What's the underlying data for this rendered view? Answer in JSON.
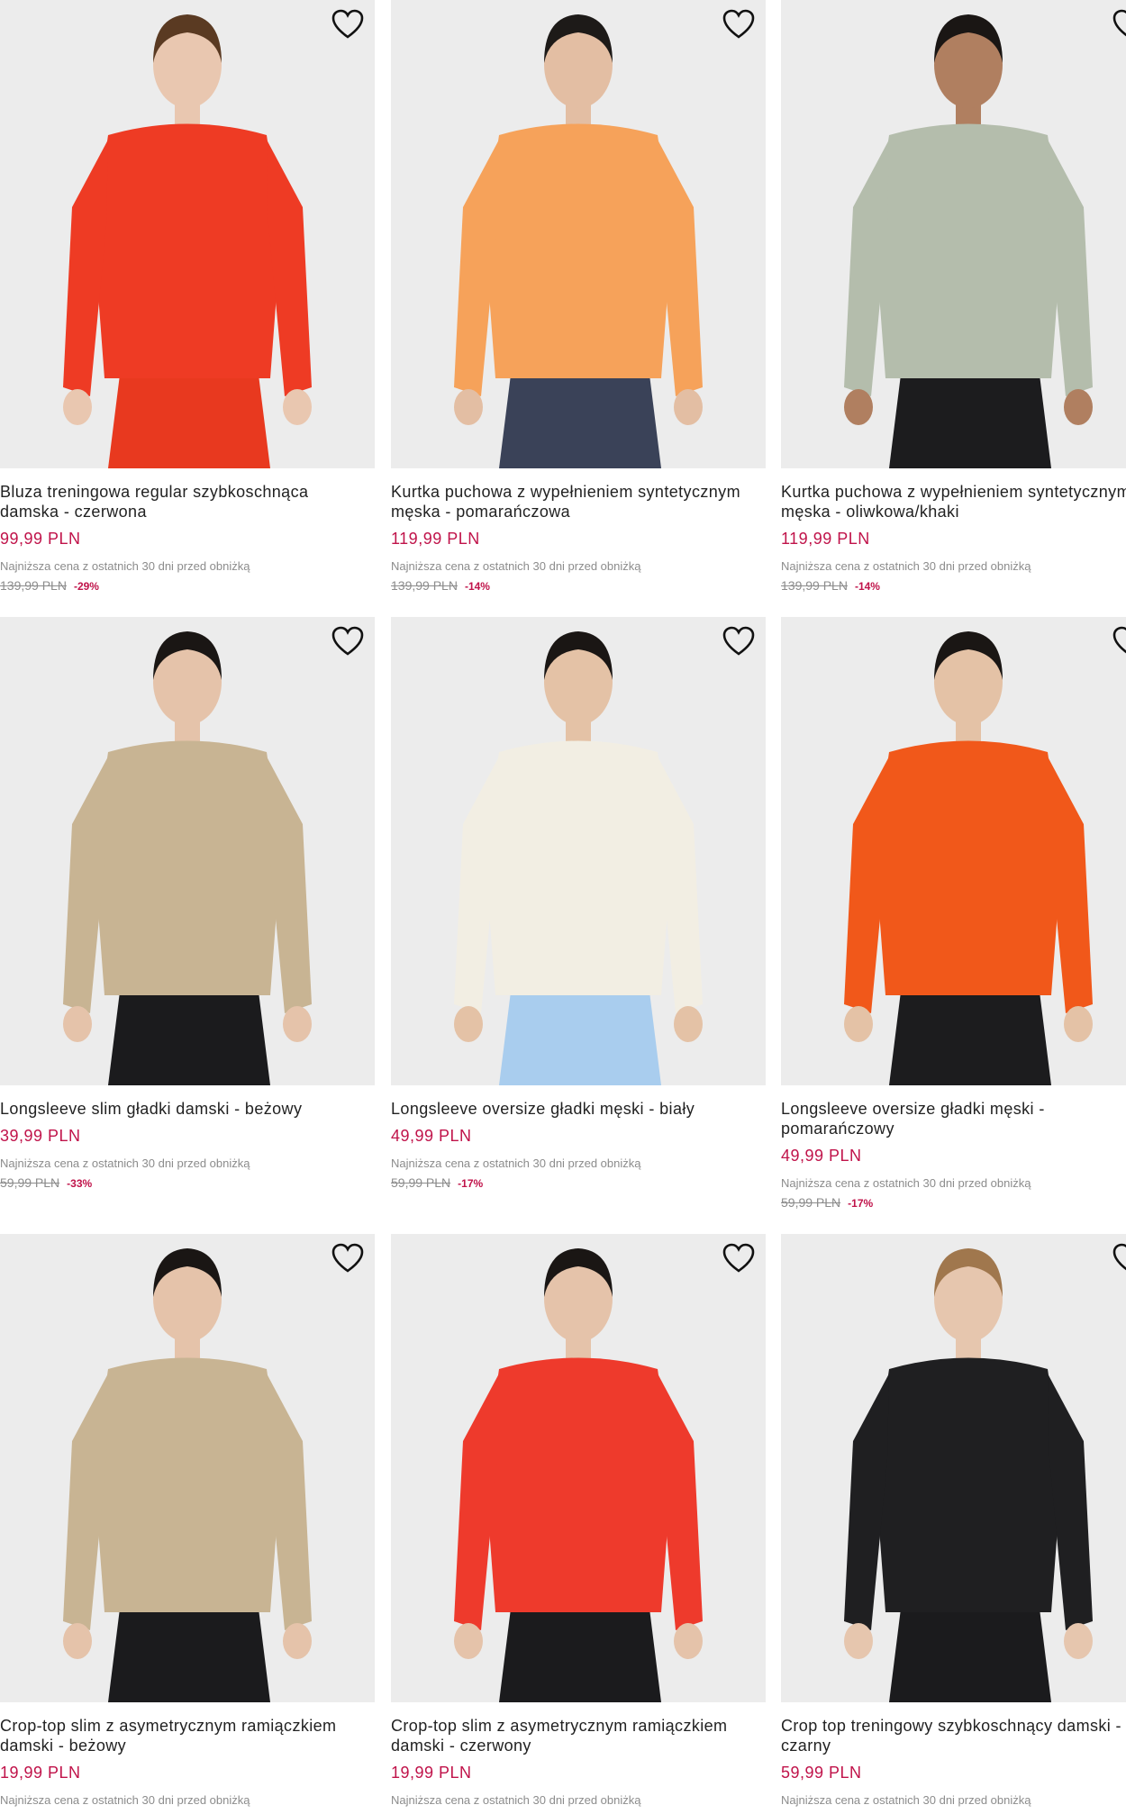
{
  "products": [
    {
      "name": "Bluza treningowa regular szybkoschnąca damska - czerwona",
      "price": "99,99 PLN",
      "lowest_note": "Najniższa cena z ostatnich 30 dni przed obniżką",
      "old_price": "139,99 PLN",
      "discount": "-29%",
      "garment_color": "#ee3b24",
      "bottom_color": "#e8391f",
      "skin": "#e9c7b0",
      "hair": "#5a3a22",
      "icon": "heart-outline"
    },
    {
      "name": "Kurtka puchowa z wypełnieniem syntetycznym męska - pomarańczowa",
      "price": "119,99 PLN",
      "lowest_note": "Najniższa cena z ostatnich 30 dni przed obniżką",
      "old_price": "139,99 PLN",
      "discount": "-14%",
      "garment_color": "#f6a25a",
      "bottom_color": "#3a4258",
      "skin": "#e3bea3",
      "hair": "#1d1a18",
      "icon": "heart-outline"
    },
    {
      "name": "Kurtka puchowa z wypełnieniem syntetycznym męska - oliwkowa/khaki",
      "price": "119,99 PLN",
      "lowest_note": "Najniższa cena z ostatnich 30 dni przed obniżką",
      "old_price": "139,99 PLN",
      "discount": "-14%",
      "garment_color": "#b4bdac",
      "bottom_color": "#1c1c1e",
      "skin": "#b07f60",
      "hair": "#1a1614",
      "icon": "heart-outline"
    },
    {
      "name": "Longsleeve slim gładki damski - beżowy",
      "price": "39,99 PLN",
      "lowest_note": "Najniższa cena z ostatnich 30 dni przed obniżką",
      "old_price": "59,99 PLN",
      "discount": "-33%",
      "garment_color": "#c8b493",
      "bottom_color": "#1b1b1d",
      "skin": "#e5c3aa",
      "hair": "#1a1614",
      "icon": "heart-outline"
    },
    {
      "name": "Longsleeve oversize gładki męski - biały",
      "price": "49,99 PLN",
      "lowest_note": "Najniższa cena z ostatnich 30 dni przed obniżką",
      "old_price": "59,99 PLN",
      "discount": "-17%",
      "garment_color": "#f2eee3",
      "bottom_color": "#a9cdee",
      "skin": "#e4c2a6",
      "hair": "#1a1614",
      "icon": "heart-outline"
    },
    {
      "name": "Longsleeve oversize gładki męski - pomarańczowy",
      "price": "49,99 PLN",
      "lowest_note": "Najniższa cena z ostatnich 30 dni przed obniżką",
      "old_price": "59,99 PLN",
      "discount": "-17%",
      "garment_color": "#f1581a",
      "bottom_color": "#1c1c1e",
      "skin": "#e4c2a6",
      "hair": "#1a1614",
      "icon": "heart-outline"
    },
    {
      "name": "Crop-top slim z asymetrycznym ramiączkiem damski - beżowy",
      "price": "19,99 PLN",
      "lowest_note": "Najniższa cena z ostatnich 30 dni przed obniżką",
      "old_price": "",
      "discount": "",
      "garment_color": "#c8b493",
      "bottom_color": "#1b1b1d",
      "skin": "#e5c3aa",
      "hair": "#1a1614",
      "icon": "heart-outline"
    },
    {
      "name": "Crop-top slim z asymetrycznym ramiączkiem damski - czerwony",
      "price": "19,99 PLN",
      "lowest_note": "Najniższa cena z ostatnich 30 dni przed obniżką",
      "old_price": "",
      "discount": "",
      "garment_color": "#ee3a2c",
      "bottom_color": "#1b1b1d",
      "skin": "#e5c3aa",
      "hair": "#1a1614",
      "icon": "heart-outline"
    },
    {
      "name": "Crop top treningowy szybkoschnący damski - czarny",
      "price": "59,99 PLN",
      "lowest_note": "Najniższa cena z ostatnich 30 dni przed obniżką",
      "old_price": "",
      "discount": "",
      "garment_color": "#1f1f21",
      "bottom_color": "#1b1b1d",
      "skin": "#e6c6ae",
      "hair": "#a0774d",
      "icon": "heart-outline"
    }
  ]
}
